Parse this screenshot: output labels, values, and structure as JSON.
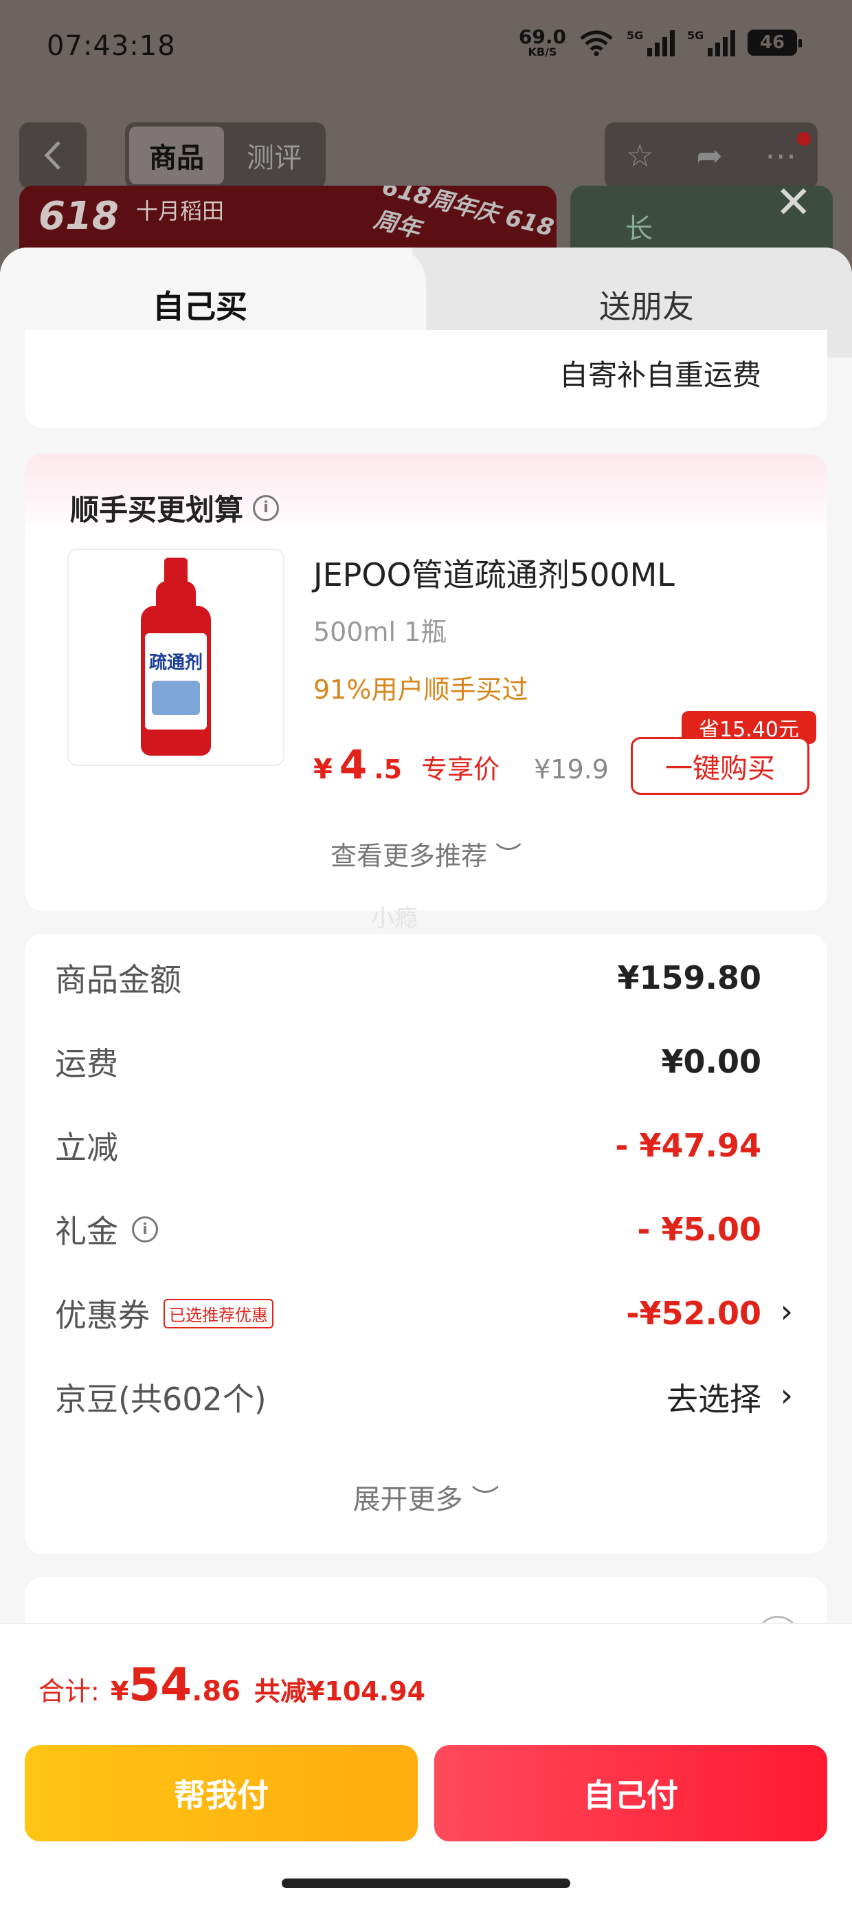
{
  "status_bar": {
    "time": "07:43:18",
    "net_speed": "69.0",
    "net_unit": "KB/S",
    "sig1": "5G",
    "sig2": "5G",
    "battery": "46"
  },
  "header": {
    "tab_goods": "商品",
    "tab_review": "测评"
  },
  "banner": {
    "logo_618": "618",
    "brand": "十月稻田",
    "slogan": "618周年庆  618周年",
    "right": "长"
  },
  "sheet": {
    "tab_self": "自己买",
    "tab_friend": "送朋友",
    "partial_text": "自寄补自重运费"
  },
  "recommend": {
    "title": "顺手买更划算",
    "product_name": "JEPOO管道疏通剂500ML",
    "spec": "500ml 1瓶",
    "rate": "91%用户顺手买过",
    "price_currency": "¥",
    "price_int": "4",
    "price_dec": ".5",
    "price_tag": "专享价",
    "orig_price": "¥19.9",
    "save_badge": "省15.40元",
    "buy_button": "一键购买",
    "more": "查看更多推荐 ︶",
    "bottle_text": "疏通剂"
  },
  "watermark": "小瘾",
  "summary": {
    "goods_label": "商品金额",
    "goods_value": "¥159.80",
    "shipping_label": "运费",
    "shipping_value": "¥0.00",
    "discount_label": "立减",
    "discount_value": "- ¥47.94",
    "gift_label": "礼金",
    "gift_value": "- ¥5.00",
    "coupon_label": "优惠券",
    "coupon_tag": "已选推荐优惠",
    "coupon_value": "-¥52.00",
    "jd_label": "京豆(共602个)",
    "jd_value": "去选择",
    "expand": "展开更多 ︶"
  },
  "footer": {
    "total_label": "合计:",
    "total_currency": "¥",
    "total_int": "54",
    "total_dec": ".86",
    "total_reduce": "共减¥104.94",
    "help_pay": "帮我付",
    "self_pay": "自己付"
  },
  "colors": {
    "accent_red": "#e2231a",
    "orange": "#d8851a",
    "yellow_button": "#ffbb12",
    "red_button": "#ff2a40"
  }
}
